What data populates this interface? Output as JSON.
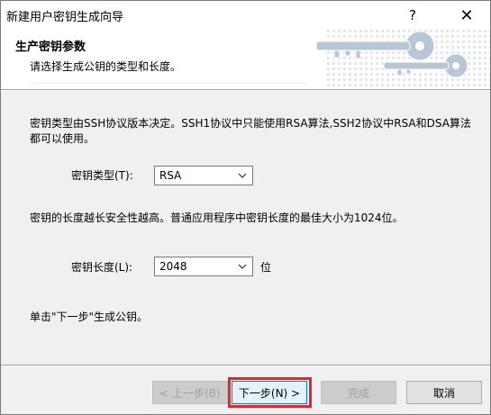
{
  "window": {
    "title": "新建用户密钥生成向导",
    "help_glyph": "?",
    "close_glyph": "✕"
  },
  "header": {
    "title": "生产密钥参数",
    "subtitle": "请选择生成公钥的类型和长度。"
  },
  "body": {
    "intro_text": "密钥类型由SSH协议版本决定。SSH1协议中只能使用RSA算法,SSH2协议中RSA和DSA算法都可以使用。",
    "key_type": {
      "label": "密钥类型(T):",
      "value": "RSA"
    },
    "length_text": "密钥的长度越长安全性越高。普通应用程序中密钥长度的最佳大小为1024位。",
    "key_length": {
      "label": "密钥长度(L):",
      "value": "2048",
      "unit": "位"
    },
    "instruction_text": "单击\"下一步\"生成公钥。"
  },
  "buttons": {
    "back": "< 上一步(B)",
    "next": "下一步(N) >",
    "finish": "完成",
    "cancel": "取消"
  },
  "colors": {
    "highlight": "#e8232a",
    "keys_art": "#a9b9c9"
  }
}
